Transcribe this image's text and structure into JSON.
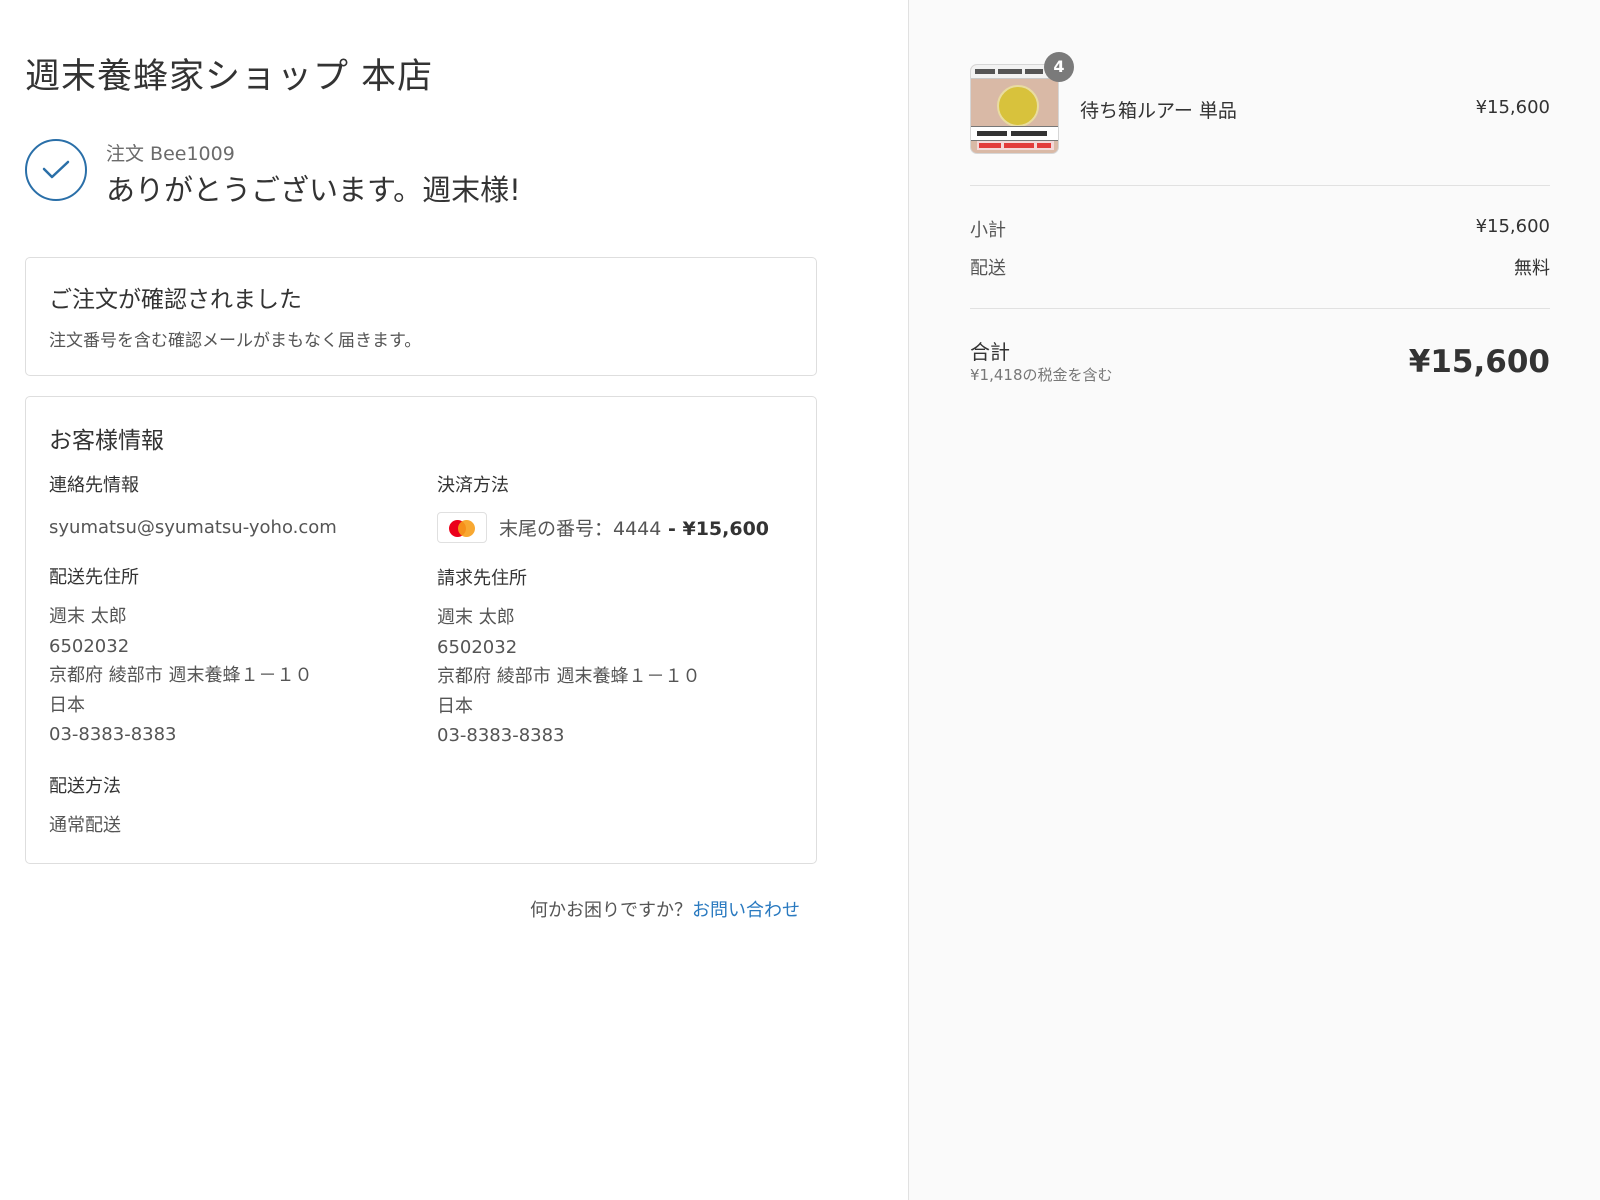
{
  "shop": {
    "title": "週末養蜂家ショップ 本店"
  },
  "order": {
    "number": "注文 Bee1009",
    "thanks": "ありがとうございます。週末様!"
  },
  "confirmation": {
    "title": "ご注文が確認されました",
    "message": "注文番号を含む確認メールがまもなく届きます。"
  },
  "customer": {
    "title": "お客様情報",
    "contact": {
      "label": "連絡先情報",
      "email": "syumatsu@syumatsu-yoho.com"
    },
    "payment": {
      "label": "決済方法",
      "card_brand_icon": "mastercard-icon",
      "text": "末尾の番号：4444",
      "amount": " - ¥15,600"
    },
    "shipping_address": {
      "label": "配送先住所",
      "lines": [
        "週末 太郎",
        "6502032",
        "京都府 綾部市 週末養蜂１－１０",
        "日本",
        "03-8383-8383"
      ]
    },
    "billing_address": {
      "label": "請求先住所",
      "lines": [
        "週末 太郎",
        "6502032",
        "京都府 綾部市 週末養蜂１－１０",
        "日本",
        "03-8383-8383"
      ]
    },
    "shipping_method": {
      "label": "配送方法",
      "value": "通常配送"
    }
  },
  "help": {
    "text": "何かお困りですか？",
    "link": "お問い合わせ"
  },
  "summary": {
    "item": {
      "name": "待ち箱ルアー 単品",
      "quantity": "4",
      "price": "¥15,600"
    },
    "subtotal": {
      "label": "小計",
      "value": "¥15,600"
    },
    "shipping": {
      "label": "配送",
      "value": "無料"
    },
    "total": {
      "label": "合計",
      "tax_note": "¥1,418の税金を含む",
      "value": "¥15,600"
    }
  },
  "colors": {
    "accent_link": "#2a7ac0",
    "check_circle": "#2a6fa8",
    "sidebar_bg": "#fafafa"
  }
}
